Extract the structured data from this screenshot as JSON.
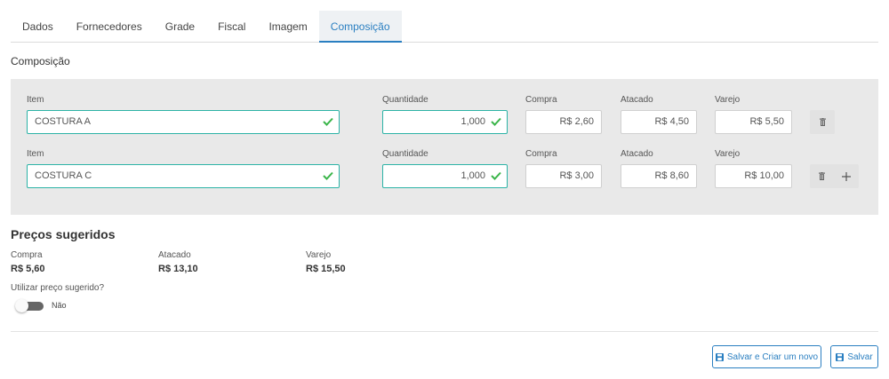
{
  "tabs": [
    "Dados",
    "Fornecedores",
    "Grade",
    "Fiscal",
    "Imagem",
    "Composição"
  ],
  "active_tab": "Composição",
  "section_title": "Composição",
  "labels": {
    "item": "Item",
    "quantidade": "Quantidade",
    "compra": "Compra",
    "atacado": "Atacado",
    "varejo": "Varejo"
  },
  "rows": [
    {
      "item": "COSTURA  A",
      "quantidade": "1,000",
      "compra": "R$ 2,60",
      "atacado": "R$ 4,50",
      "varejo": "R$ 5,50"
    },
    {
      "item": "COSTURA  C",
      "quantidade": "1,000",
      "compra": "R$ 3,00",
      "atacado": "R$ 8,60",
      "varejo": "R$ 10,00"
    }
  ],
  "suggested": {
    "title": "Preços sugeridos",
    "compra_label": "Compra",
    "compra_value": "R$ 5,60",
    "atacado_label": "Atacado",
    "atacado_value": "R$ 13,10",
    "varejo_label": "Varejo",
    "varejo_value": "R$ 15,50",
    "use_question": "Utilizar preço sugerido?",
    "toggle_label": "Não",
    "toggle_on": false
  },
  "actions": {
    "save_and_new": "Salvar e Criar um novo",
    "save": "Salvar"
  },
  "icons": {
    "valid": "check-icon",
    "delete": "trash-icon",
    "add": "plus-icon",
    "save": "floppy-disk-icon"
  },
  "colors": {
    "accent": "#2a7fc1",
    "valid": "#2cb3a6",
    "check": "#3bb54a"
  }
}
